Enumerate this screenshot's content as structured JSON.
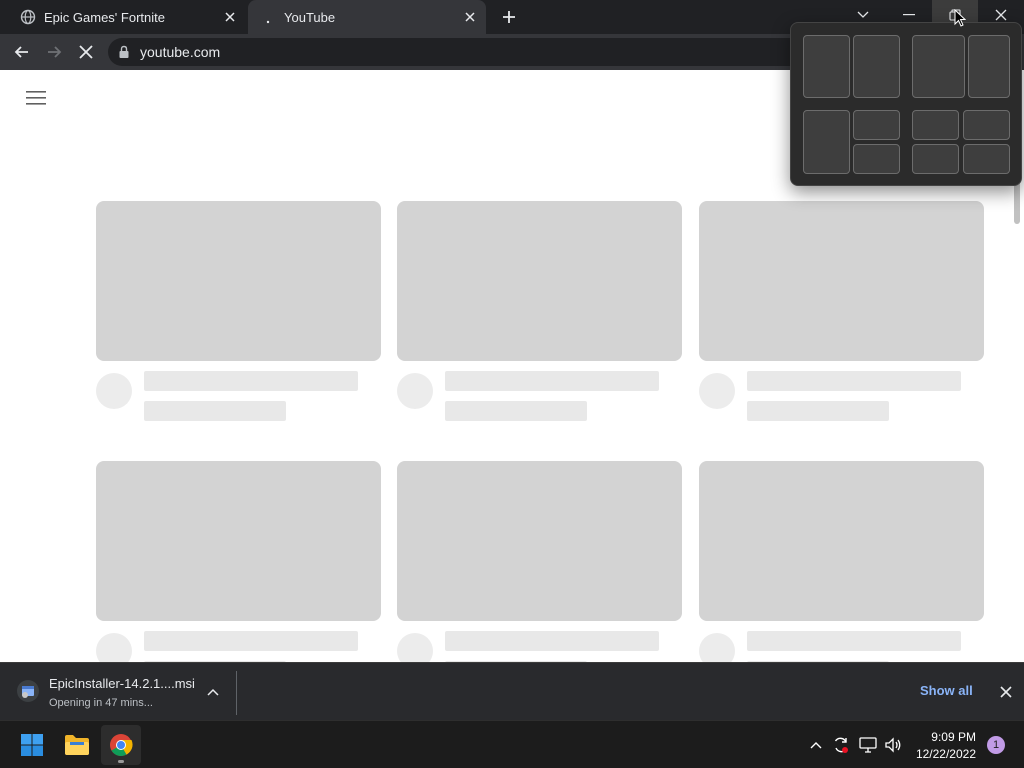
{
  "browser": {
    "tabs": [
      {
        "title": "Epic Games' Fortnite",
        "favicon": "globe-icon",
        "active": false
      },
      {
        "title": "YouTube",
        "favicon": "loading-icon",
        "active": true
      }
    ],
    "address": {
      "url": "youtube.com"
    }
  },
  "colors": {
    "tabstrip": "#202124",
    "toolbar": "#35363a",
    "skeleton_thumb": "#d3d3d3",
    "skeleton_line": "#e8e8e8",
    "link_blue": "#8ab4f8"
  },
  "download": {
    "filename": "EpicInstaller-14.2.1....msi",
    "status": "Opening in 47 mins...",
    "show_all": "Show all"
  },
  "snap_layout": {
    "layouts": [
      "two-equal-columns",
      "wide-left-narrow-right",
      "left-column-right-stack",
      "four-quadrants"
    ]
  },
  "taskbar": {
    "apps": [
      "windows-start-icon",
      "file-explorer-icon",
      "chrome-icon"
    ],
    "tray_icons": [
      "chevron-up-icon",
      "sync-icon",
      "network-icon",
      "volume-icon"
    ],
    "time": "9:09 PM",
    "date": "12/22/2022",
    "notification_count": "1"
  }
}
